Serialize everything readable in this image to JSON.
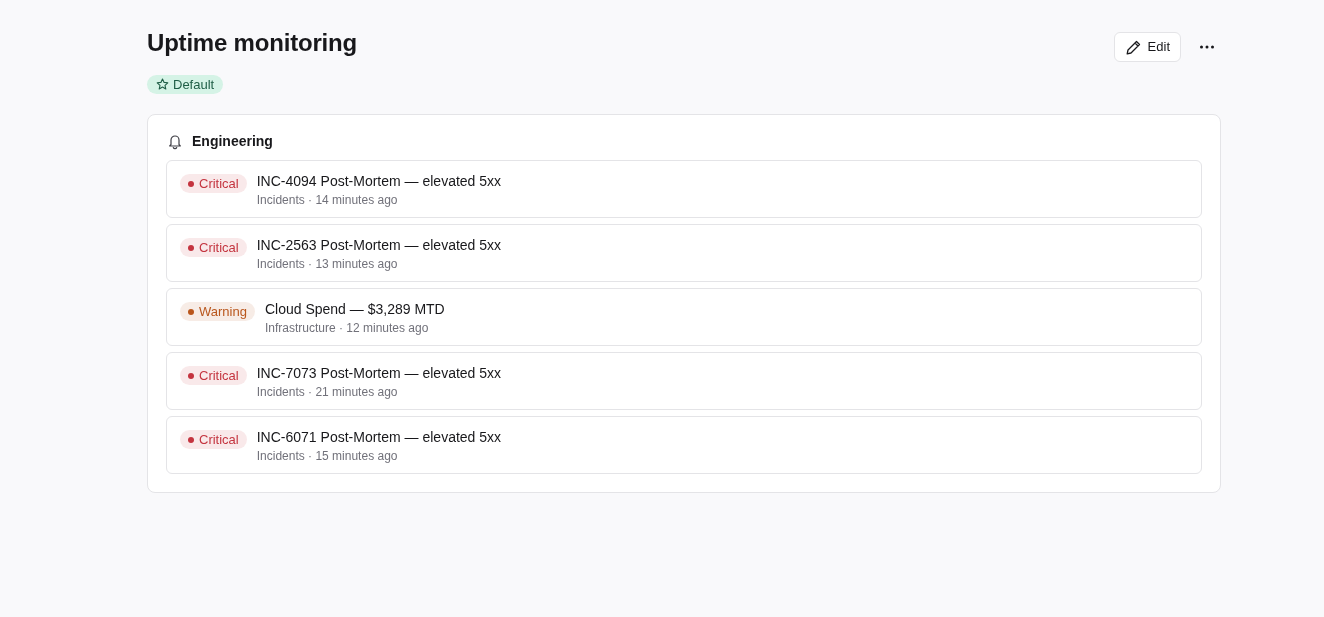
{
  "page": {
    "title": "Uptime monitoring",
    "tag": {
      "label": "Default"
    },
    "actions": [
      {
        "kind": "edit",
        "label": "Edit"
      },
      {
        "kind": "more"
      }
    ]
  },
  "group": {
    "title": "Engineering",
    "alerts": [
      {
        "severity": "Critical",
        "color": "#c4343f",
        "title": "INC-4094 Post-Mortem — elevated 5xx",
        "meta": "Incidents · 14 minutes ago"
      },
      {
        "severity": "Critical",
        "color": "#c4343f",
        "title": "INC-2563 Post-Mortem — elevated 5xx",
        "meta": "Incidents · 13 minutes ago"
      },
      {
        "severity": "Warning",
        "color": "#b9561c",
        "title": "Cloud Spend — $3,289 MTD",
        "meta": "Infrastructure · 12 minutes ago"
      },
      {
        "severity": "Critical",
        "color": "#c4343f",
        "title": "INC-7073 Post-Mortem — elevated 5xx",
        "meta": "Incidents · 21 minutes ago"
      },
      {
        "severity": "Critical",
        "color": "#c4343f",
        "title": "INC-6071 Post-Mortem — elevated 5xx",
        "meta": "Incidents · 15 minutes ago"
      }
    ]
  }
}
